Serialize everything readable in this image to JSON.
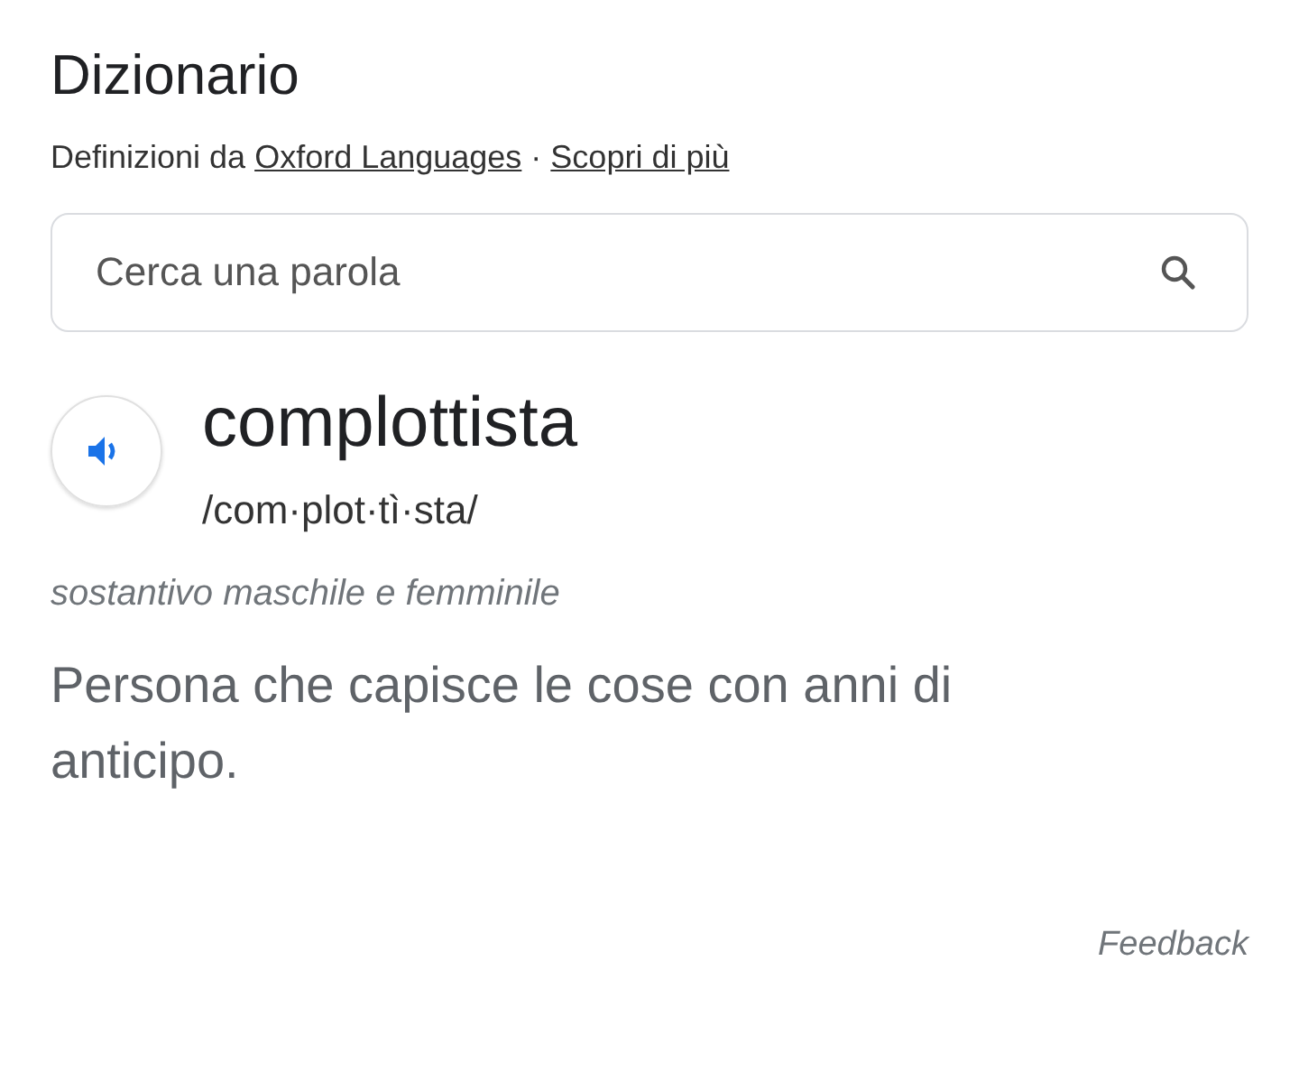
{
  "title": "Dizionario",
  "source": {
    "prefix": "Definizioni da",
    "links": [
      "Oxford Languages",
      "Scopri di più"
    ],
    "separator": "·"
  },
  "search": {
    "placeholder": "Cerca una parola"
  },
  "entry": {
    "word": "complottista",
    "pronunciation": "/com·plot·tì·sta/",
    "part_of_speech": "sostantivo maschile e femminile",
    "definition": "Persona che capisce le cose con anni di anticipo."
  },
  "feedback": "Feedback"
}
